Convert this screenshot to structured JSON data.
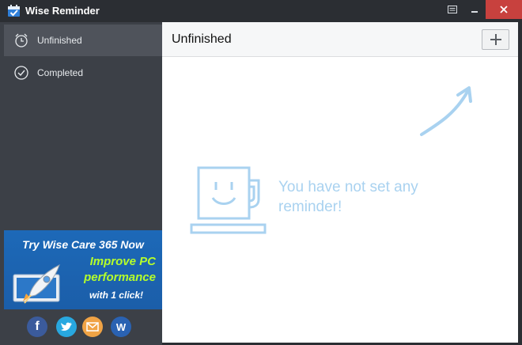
{
  "window": {
    "title": "Wise Reminder"
  },
  "sidebar": {
    "items": [
      {
        "label": "Unfinished",
        "icon": "alarm-clock-icon",
        "active": true
      },
      {
        "label": "Completed",
        "icon": "check-circle-icon",
        "active": false
      }
    ]
  },
  "ad": {
    "line1": "Try Wise Care 365 Now",
    "line2a": "Improve PC",
    "line2b": "performance",
    "line3": "with 1 click!"
  },
  "social": [
    "facebook-icon",
    "twitter-icon",
    "email-icon",
    "wise-icon"
  ],
  "main": {
    "title": "Unfinished",
    "empty_line1": "You have not set any",
    "empty_line2": "reminder!"
  },
  "colors": {
    "titlebar": "#2b2e33",
    "sidebar": "#3c4047",
    "close": "#c8413e",
    "empty_accent": "#a9d2f0"
  }
}
